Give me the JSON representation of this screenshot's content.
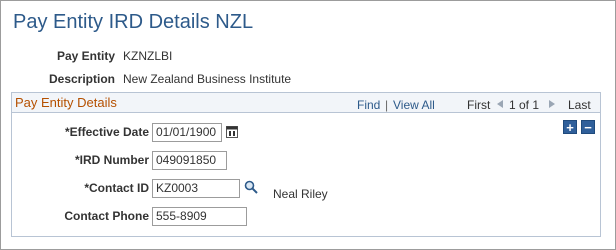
{
  "page": {
    "title": "Pay Entity IRD Details NZL"
  },
  "header": {
    "pay_entity_label": "Pay Entity",
    "pay_entity_value": "KZNZLBI",
    "description_label": "Description",
    "description_value": "New Zealand Business Institute"
  },
  "section": {
    "title": "Pay Entity Details",
    "nav": {
      "find": "Find",
      "separator": "|",
      "view_all": "View All",
      "first": "First",
      "range": "1 of 1",
      "last": "Last"
    },
    "add_row": "+",
    "delete_row": "−"
  },
  "fields": {
    "effective_date_label": "*Effective Date",
    "effective_date_value": "01/01/1900",
    "ird_number_label": "*IRD Number",
    "ird_number_value": "049091850",
    "contact_id_label": "*Contact ID",
    "contact_id_value": "KZ0003",
    "contact_name": "Neal Riley",
    "contact_phone_label": "Contact Phone",
    "contact_phone_value": "555-8909"
  },
  "icons": {
    "calendar": "calendar-icon",
    "lookup": "search-icon",
    "first_arrow": "first-arrow-icon",
    "last_arrow": "last-arrow-icon"
  },
  "colors": {
    "title": "#2d5a8a",
    "section_title": "#b55000",
    "link": "#2d5a8a",
    "button": "#2f5f9a"
  }
}
